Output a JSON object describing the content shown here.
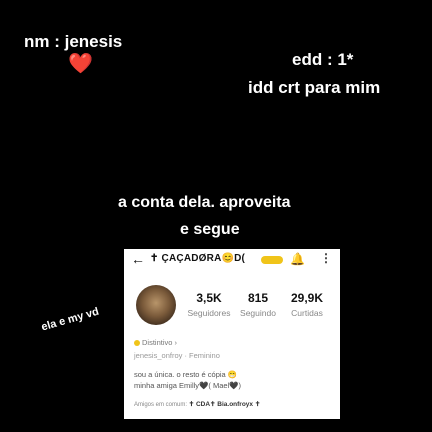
{
  "overlay": {
    "name_line": "nm : jenesis",
    "heart": "❤️",
    "edd_line": "edd : 1*",
    "idd_line": "idd crt para mim",
    "caption_1": "a conta dela. aproveita",
    "caption_2": "e segue",
    "side_note": "ela e my vd"
  },
  "profile": {
    "back_icon": "←",
    "username": "✝ ÇAÇADØRA😊D(",
    "badge_color": "#f0c419",
    "notification_icon": "🔔",
    "more_icon": "⋮",
    "stats": [
      {
        "value": "3,5K",
        "label": "Seguidores"
      },
      {
        "value": "815",
        "label": "Seguindo"
      },
      {
        "value": "29,9K",
        "label": "Curtidas"
      }
    ],
    "distintivo": "Distintivo ›",
    "handle_line": "jenesis_onfroy · Feminino",
    "bio_lines": [
      "sou a única. o resto é cópia 😁",
      "minha amiga Emilly🖤( Mael🖤)"
    ],
    "amigos_label": "Amigos em comum:",
    "amigos_names": "✝ CDA✝  Bia.onfroyx ✝"
  }
}
